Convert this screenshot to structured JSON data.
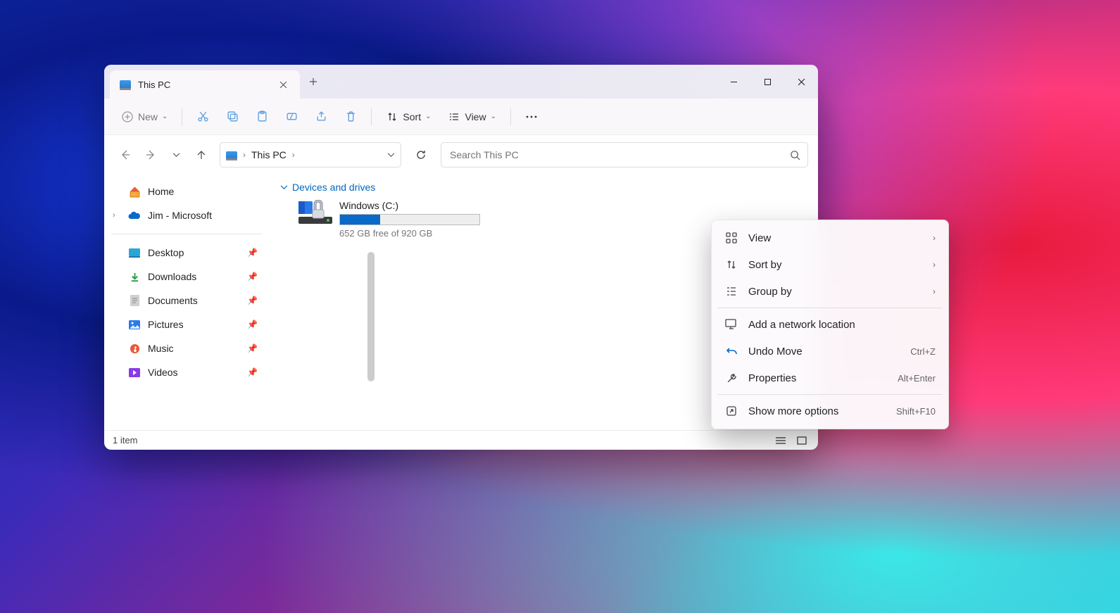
{
  "tab": {
    "title": "This PC"
  },
  "toolbar": {
    "new_label": "New",
    "sort_label": "Sort",
    "view_label": "View"
  },
  "address": {
    "location": "This PC"
  },
  "search": {
    "placeholder": "Search This PC"
  },
  "sidebar": {
    "home": "Home",
    "onedrive": "Jim - Microsoft",
    "quick": [
      {
        "label": "Desktop"
      },
      {
        "label": "Downloads"
      },
      {
        "label": "Documents"
      },
      {
        "label": "Pictures"
      },
      {
        "label": "Music"
      },
      {
        "label": "Videos"
      }
    ]
  },
  "content": {
    "group_header": "Devices and drives",
    "drive": {
      "name": "Windows  (C:)",
      "free_text": "652 GB free of 920 GB",
      "used_percent": 29
    }
  },
  "status": {
    "item_count": "1 item"
  },
  "context_menu": {
    "view": "View",
    "sort_by": "Sort by",
    "group_by": "Group by",
    "add_network": "Add a network location",
    "undo_move": "Undo Move",
    "undo_shortcut": "Ctrl+Z",
    "properties": "Properties",
    "properties_shortcut": "Alt+Enter",
    "show_more": "Show more options",
    "show_more_shortcut": "Shift+F10"
  }
}
